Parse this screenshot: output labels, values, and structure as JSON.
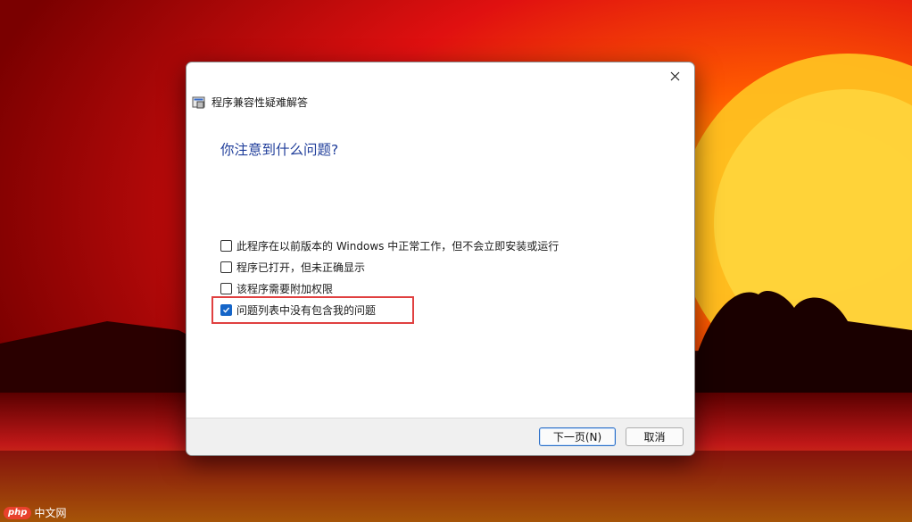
{
  "dialog": {
    "title": "程序兼容性疑难解答",
    "heading": "你注意到什么问题?",
    "options": [
      {
        "label": "此程序在以前版本的 Windows 中正常工作，但不会立即安装或运行",
        "checked": false
      },
      {
        "label": "程序已打开，但未正确显示",
        "checked": false
      },
      {
        "label": "该程序需要附加权限",
        "checked": false
      },
      {
        "label": "问题列表中没有包含我的问题",
        "checked": true
      }
    ],
    "next_label": "下一页(N)",
    "cancel_label": "取消",
    "accent_color": "#1565c8",
    "heading_color": "#1f3d9a",
    "highlight_color": "#e04040"
  },
  "watermark": {
    "badge": "php",
    "text": "中文网"
  }
}
